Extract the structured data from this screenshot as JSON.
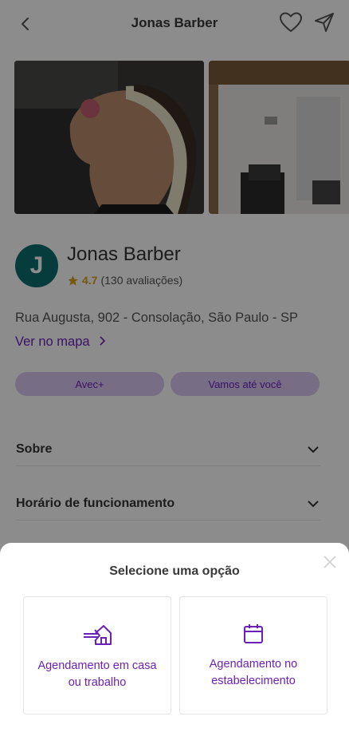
{
  "header": {
    "title": "Jonas Barber",
    "back_icon": "chevron-left-icon",
    "favorite_icon": "heart-icon",
    "share_icon": "send-icon"
  },
  "profile": {
    "avatar_letter": "J",
    "avatar_color": "#0d6e6e",
    "name": "Jonas Barber",
    "rating": "4.7",
    "reviews": "(130 avaliações)",
    "address": "Rua Augusta, 902 - Consolação, São Paulo - SP",
    "map_link": "Ver no mapa"
  },
  "chips": [
    {
      "label": "Avec+"
    },
    {
      "label": "Vamos até você"
    }
  ],
  "sections": [
    {
      "title": "Sobre"
    },
    {
      "title": "Horário de funcionamento"
    }
  ],
  "sheet": {
    "title": "Selecione uma opção",
    "options": [
      {
        "label": "Agendamento em casa ou trabalho",
        "icon": "house-enter-icon"
      },
      {
        "label": "Agendamento no estabelecimento",
        "icon": "calendar-icon"
      }
    ]
  },
  "colors": {
    "accent": "#6b21b8",
    "rating_star": "#d6a21c",
    "chip_bg": "#d9c7f2"
  }
}
